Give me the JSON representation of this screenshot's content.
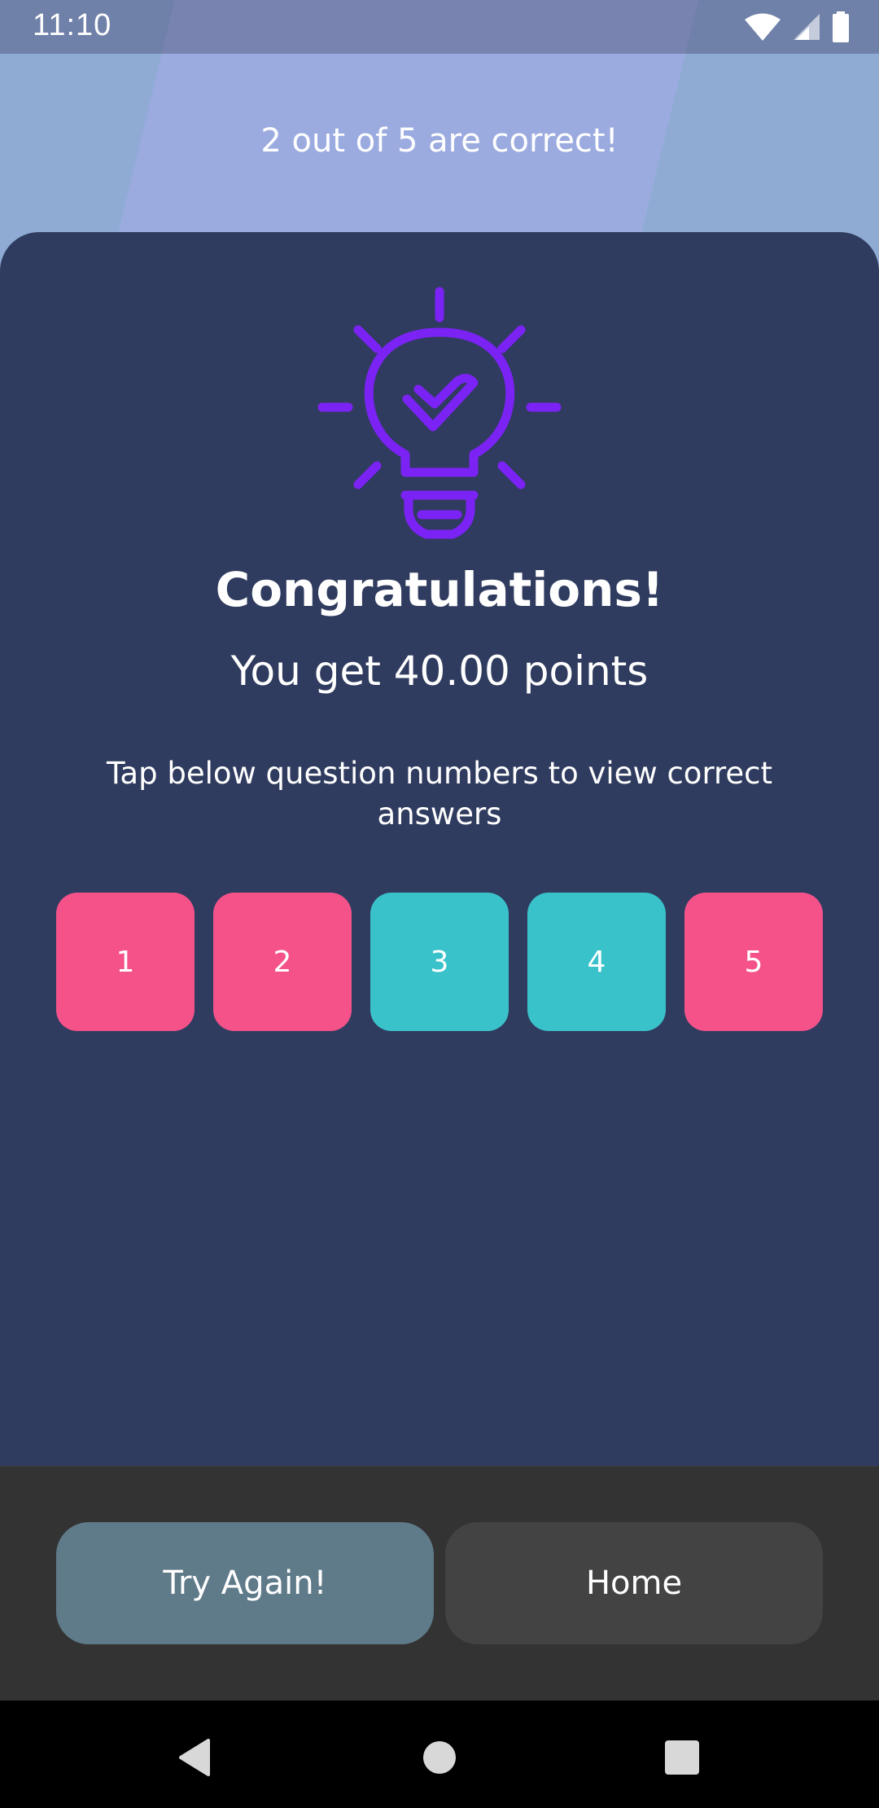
{
  "status_bar": {
    "time": "11:10",
    "icons": [
      "wifi-icon",
      "cell-signal-icon",
      "battery-icon"
    ]
  },
  "header": {
    "result_text": "2 out of 5 are correct!"
  },
  "card": {
    "icon": "lightbulb-check-icon",
    "title": "Congratulations!",
    "points_text": "You get 40.00 points",
    "hint": "Tap below question numbers to view correct answers",
    "questions": [
      {
        "label": "1",
        "status": "incorrect"
      },
      {
        "label": "2",
        "status": "incorrect"
      },
      {
        "label": "3",
        "status": "correct"
      },
      {
        "label": "4",
        "status": "correct"
      },
      {
        "label": "5",
        "status": "incorrect"
      }
    ]
  },
  "actions": {
    "try_again": "Try Again!",
    "home": "Home"
  },
  "nav_bar": {
    "icons": [
      "back-icon",
      "home-circle-icon",
      "recents-icon"
    ]
  },
  "colors": {
    "top_background": "#8fabd4",
    "card_background": "#303c5f",
    "incorrect": "#f5528a",
    "correct": "#3ac2cb",
    "icon_accent": "#7b22f5",
    "try_again_button": "#5f7a89",
    "home_button": "#434343",
    "action_bar": "#333333"
  }
}
